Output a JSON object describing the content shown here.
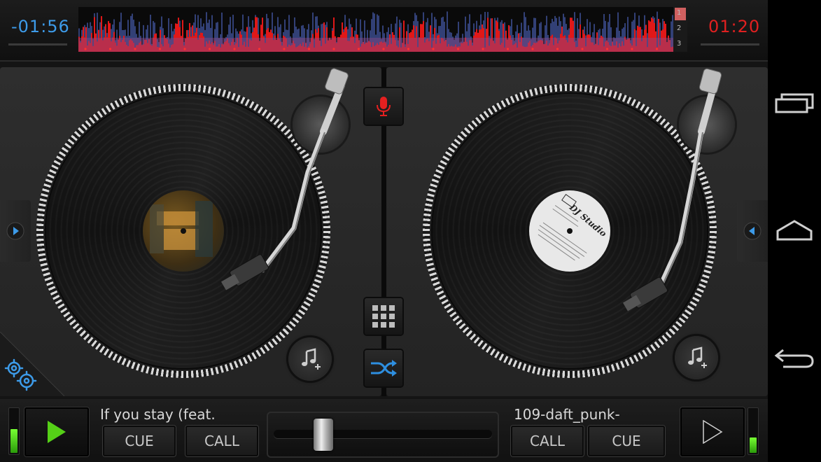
{
  "top": {
    "left_time": "-01:56",
    "right_time": "01:20",
    "waveform_markers": [
      "1",
      "2",
      "3"
    ]
  },
  "colors": {
    "left_accent": "#3d9be9",
    "right_accent": "#e02020",
    "record_icon": "#e52020",
    "shuffle_icon": "#2e8fe0",
    "play_icon": "#55d017"
  },
  "left_deck": {
    "track_name": "If you stay (feat.",
    "cue_label": "CUE",
    "call_label": "CALL",
    "level": 0.55
  },
  "right_deck": {
    "track_name": "109-daft_punk-",
    "call_label": "CALL",
    "cue_label": "CUE",
    "level": 0.35,
    "record_label": "DJ Studio"
  },
  "crossfader": {
    "position": 0.2
  },
  "icons": {
    "record": "microphone-icon",
    "sampler": "grid-icon",
    "shuffle": "shuffle-icon",
    "settings": "gears-icon",
    "add_music": "music-note-add-icon"
  }
}
